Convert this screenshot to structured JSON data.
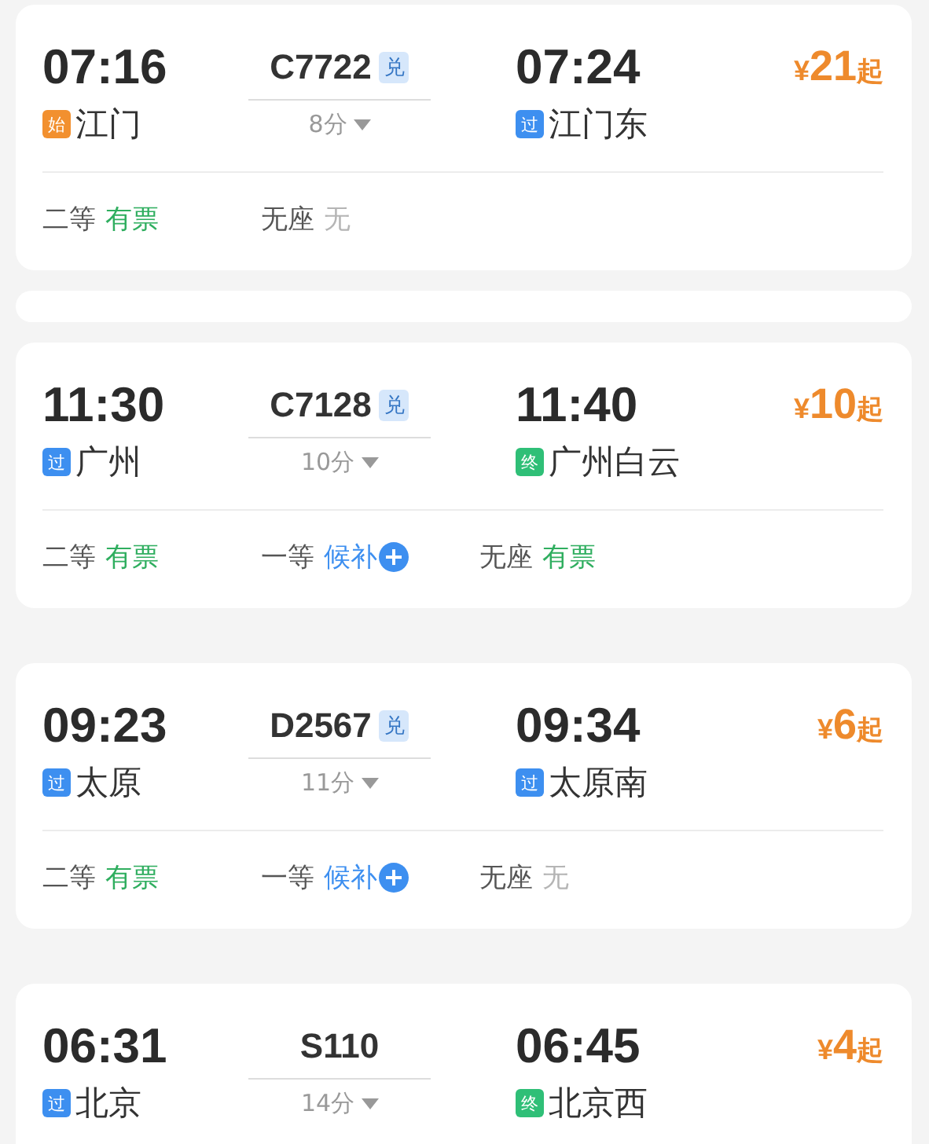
{
  "trains": [
    {
      "dep_time": "07:16",
      "dep_badge": {
        "text": "始",
        "kind": "start"
      },
      "dep_station": "江门",
      "train_no": "C7722",
      "exchange": "兑",
      "duration": "8分",
      "arr_time": "07:24",
      "arr_badge": {
        "text": "过",
        "kind": "pass"
      },
      "arr_station": "江门东",
      "price": {
        "currency": "¥",
        "amount": "21",
        "suffix": "起"
      },
      "seats": [
        {
          "class": "二等",
          "status": "有票",
          "kind": "available"
        },
        {
          "class": "无座",
          "status": "无",
          "kind": "none"
        }
      ]
    },
    {
      "dep_time": "11:30",
      "dep_badge": {
        "text": "过",
        "kind": "pass"
      },
      "dep_station": "广州",
      "train_no": "C7128",
      "exchange": "兑",
      "duration": "10分",
      "arr_time": "11:40",
      "arr_badge": {
        "text": "终",
        "kind": "end"
      },
      "arr_station": "广州白云",
      "price": {
        "currency": "¥",
        "amount": "10",
        "suffix": "起"
      },
      "seats": [
        {
          "class": "二等",
          "status": "有票",
          "kind": "available"
        },
        {
          "class": "一等",
          "status": "候补",
          "kind": "waitlist"
        },
        {
          "class": "无座",
          "status": "有票",
          "kind": "available"
        }
      ]
    },
    {
      "dep_time": "09:23",
      "dep_badge": {
        "text": "过",
        "kind": "pass"
      },
      "dep_station": "太原",
      "train_no": "D2567",
      "exchange": "兑",
      "duration": "11分",
      "arr_time": "09:34",
      "arr_badge": {
        "text": "过",
        "kind": "pass"
      },
      "arr_station": "太原南",
      "price": {
        "currency": "¥",
        "amount": "6",
        "suffix": "起"
      },
      "seats": [
        {
          "class": "二等",
          "status": "有票",
          "kind": "available"
        },
        {
          "class": "一等",
          "status": "候补",
          "kind": "waitlist"
        },
        {
          "class": "无座",
          "status": "无",
          "kind": "none"
        }
      ]
    },
    {
      "dep_time": "06:31",
      "dep_badge": {
        "text": "过",
        "kind": "pass"
      },
      "dep_station": "北京",
      "train_no": "S110",
      "duration": "14分",
      "arr_time": "06:45",
      "arr_badge": {
        "text": "终",
        "kind": "end"
      },
      "arr_station": "北京西",
      "price": {
        "currency": "¥",
        "amount": "4",
        "suffix": "起"
      }
    }
  ]
}
